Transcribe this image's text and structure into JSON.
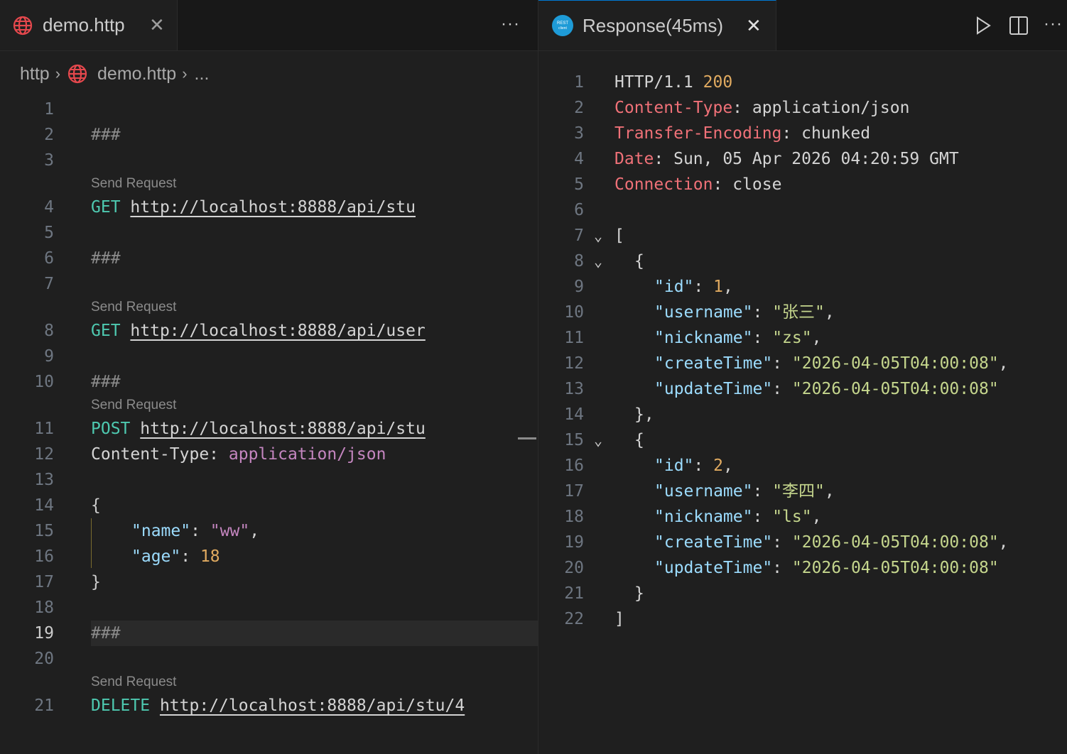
{
  "left": {
    "tab": {
      "title": "demo.http",
      "icon": "globe-icon"
    },
    "breadcrumb": {
      "root": "http",
      "file": "demo.http",
      "tail": "..."
    },
    "codelens": "Send Request",
    "lines": {
      "l1": "",
      "l2": "###",
      "l3": "",
      "l4_method": "GET",
      "l4_url": "http://localhost:8888/api/stu",
      "l5": "",
      "l6": "###",
      "l7": "",
      "l8_method": "GET",
      "l8_url": "http://localhost:8888/api/user",
      "l9": "",
      "l10": "###",
      "l11_method": "POST",
      "l11_url": "http://localhost:8888/api/stu",
      "l12_name": "Content-Type",
      "l12_sep": ": ",
      "l12_value": "application/json",
      "l13": "",
      "l14": "{",
      "l15_key": "\"name\"",
      "l15_val": "\"ww\"",
      "l16_key": "\"age\"",
      "l16_val": "18",
      "l17": "}",
      "l18": "",
      "l19": "###",
      "l20": "",
      "l21_method": "DELETE",
      "l21_url": "http://localhost:8888/api/stu/4"
    },
    "line_numbers": [
      "1",
      "2",
      "3",
      "4",
      "5",
      "6",
      "7",
      "8",
      "9",
      "10",
      "11",
      "12",
      "13",
      "14",
      "15",
      "16",
      "17",
      "18",
      "19",
      "20",
      "21"
    ],
    "active_line": "19"
  },
  "right": {
    "tab": {
      "title": "Response(45ms)",
      "icon": "rest-client-icon"
    },
    "line_numbers": [
      "1",
      "2",
      "3",
      "4",
      "5",
      "6",
      "7",
      "8",
      "9",
      "10",
      "11",
      "12",
      "13",
      "14",
      "15",
      "16",
      "17",
      "18",
      "19",
      "20",
      "21",
      "22"
    ],
    "response": {
      "status_proto": "HTTP/1.1",
      "status_code": "200",
      "h_ct_name": "Content-Type",
      "h_ct_val": "application/json",
      "h_te_name": "Transfer-Encoding",
      "h_te_val": "chunked",
      "h_date_name": "Date",
      "h_date_val": "Sun, 05 Apr 2026 04:20:59 GMT",
      "h_conn_name": "Connection",
      "h_conn_val": "close",
      "open_bracket": "[",
      "close_bracket": "]",
      "items": [
        {
          "id": "1",
          "username": "\"张三\"",
          "nickname": "\"zs\"",
          "createTime": "\"2026-04-05T04:00:08\"",
          "updateTime": "\"2026-04-05T04:00:08\""
        },
        {
          "id": "2",
          "username": "\"李四\"",
          "nickname": "\"ls\"",
          "createTime": "\"2026-04-05T04:00:08\"",
          "updateTime": "\"2026-04-05T04:00:08\""
        }
      ],
      "k_id": "\"id\"",
      "k_username": "\"username\"",
      "k_nickname": "\"nickname\"",
      "k_createTime": "\"createTime\"",
      "k_updateTime": "\"updateTime\""
    }
  },
  "colors": {
    "accent": "#0078d4",
    "background": "#1f1f1f"
  }
}
